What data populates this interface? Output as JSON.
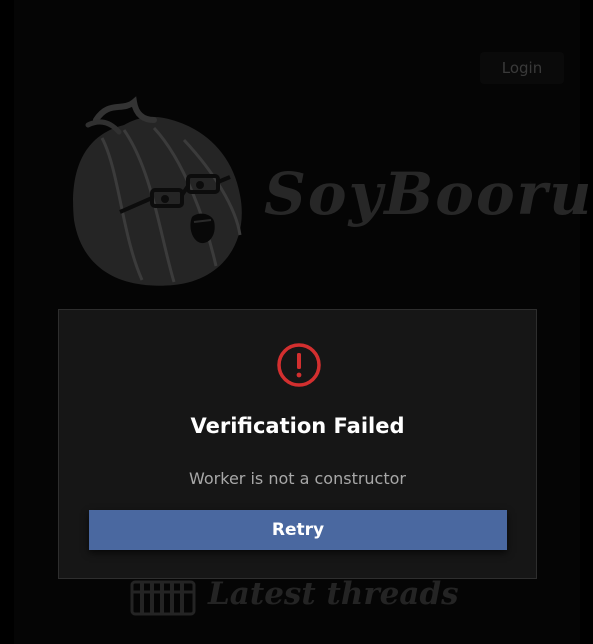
{
  "header": {
    "login_label": "Login"
  },
  "brand": {
    "site_name": "SoyBooru"
  },
  "dialog": {
    "title": "Verification Failed",
    "message": "Worker is not a constructor",
    "retry_label": "Retry",
    "icon": "alert-circle-icon",
    "accent_color": "#d32f2f"
  },
  "section": {
    "latest_threads_label": "Latest threads"
  },
  "colors": {
    "background": "#000000",
    "dialog_background": "#161616",
    "button": "#4a68a0"
  }
}
